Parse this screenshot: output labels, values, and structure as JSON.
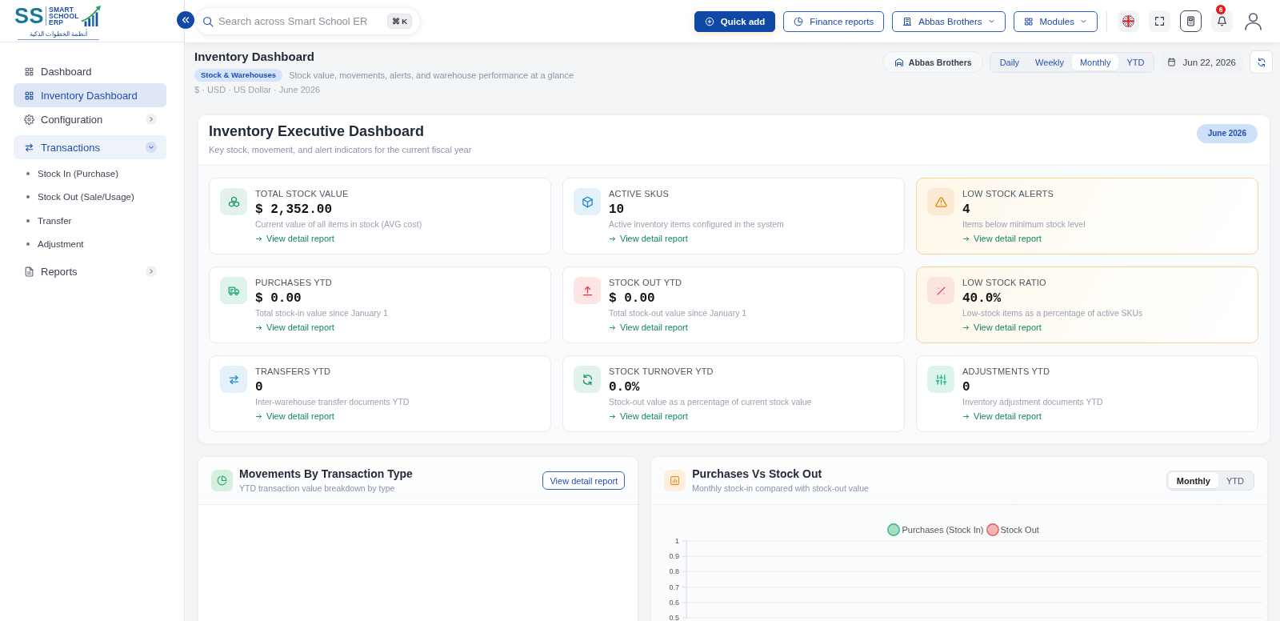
{
  "topbar": {
    "logo": {
      "mark": "SS",
      "lines": [
        "SMART",
        "SCHOOL",
        "ERP"
      ],
      "tagline": "أنظمة الخطوات الذكية"
    },
    "search": {
      "placeholder": "Search across Smart School ER",
      "shortcut": "⌘ K"
    },
    "quick_add": "Quick add",
    "finance_reports": "Finance reports",
    "company": "Abbas Brothers",
    "modules": "Modules",
    "notifications_count": "6"
  },
  "sidebar": {
    "items": [
      {
        "label": "Dashboard",
        "kind": "grid",
        "selected": false
      },
      {
        "label": "Inventory Dashboard",
        "kind": "grid",
        "selected": true
      },
      {
        "label": "Configuration",
        "kind": "settings",
        "selected": false,
        "expanded": false
      },
      {
        "label": "Transactions",
        "kind": "transfer",
        "selected": false,
        "expanded": true,
        "children": [
          {
            "label": "Stock In (Purchase)",
            "selected": false
          },
          {
            "label": "Stock Out (Sale/Usage)",
            "selected": false
          },
          {
            "label": "Transfer",
            "selected": false
          },
          {
            "label": "Adjustment",
            "selected": false
          }
        ]
      },
      {
        "label": "Reports",
        "kind": "document",
        "selected": false,
        "expanded": false
      }
    ]
  },
  "page_header": {
    "title": "Inventory Dashboard",
    "badge": "Stock & Warehouses",
    "subtitle": "Stock value, movements, alerts, and warehouse performance at a glance",
    "meta": "$ · USD · US Dollar · June 2026",
    "company": "Abbas Brothers",
    "periods": [
      {
        "label": "Daily",
        "selected": false
      },
      {
        "label": "Weekly",
        "selected": false
      },
      {
        "label": "Monthly",
        "selected": true
      },
      {
        "label": "YTD",
        "selected": false
      }
    ],
    "date": "Jun 22, 2026"
  },
  "executive": {
    "title": "Inventory Executive Dashboard",
    "subtitle": "Key stock, movement, and alert indicators for the current fiscal year",
    "period": "June 2026",
    "cards": [
      {
        "kind": "valuation",
        "label": "TOTAL STOCK VALUE",
        "value": "$ 2,352.00",
        "description": "Current value of all items in stock (AVG cost)",
        "link": "View detail report",
        "highlighted": false
      },
      {
        "kind": "skus",
        "label": "ACTIVE SKUS",
        "value": "10",
        "description": "Active inventory items configured in the system",
        "link": "View detail report",
        "highlighted": false
      },
      {
        "kind": "alerts",
        "label": "LOW STOCK ALERTS",
        "value": "4",
        "description": "Items below minimum stock level",
        "link": "View detail report",
        "highlighted": true
      },
      {
        "kind": "purchases",
        "label": "PURCHASES YTD",
        "value": "$ 0.00",
        "description": "Total stock-in value since January 1",
        "link": "View detail report",
        "highlighted": false
      },
      {
        "kind": "stockout",
        "label": "STOCK OUT YTD",
        "value": "$ 0.00",
        "description": "Total stock-out value since January 1",
        "link": "View detail report",
        "highlighted": false
      },
      {
        "kind": "ratio",
        "label": "LOW STOCK RATIO",
        "value": "40.0%",
        "description": "Low-stock items as a percentage of active SKUs",
        "link": "View detail report",
        "highlighted": true
      },
      {
        "kind": "transfers",
        "label": "TRANSFERS YTD",
        "value": "0",
        "description": "Inter-warehouse transfer documents YTD",
        "link": "View detail report",
        "highlighted": false
      },
      {
        "kind": "turnover",
        "label": "STOCK TURNOVER YTD",
        "value": "0.0%",
        "description": "Stock-out value as a percentage of current stock value",
        "link": "View detail report",
        "highlighted": false
      },
      {
        "kind": "adjustments",
        "label": "ADJUSTMENTS YTD",
        "value": "0",
        "description": "Inventory adjustment documents YTD",
        "link": "View detail report",
        "highlighted": false
      }
    ]
  },
  "movements_panel": {
    "title": "Movements By Transaction Type",
    "subtitle": "YTD transaction value breakdown by type",
    "action": "View detail report"
  },
  "purchases_panel": {
    "title": "Purchases Vs Stock Out",
    "subtitle": "Monthly stock-in compared with stock-out value",
    "periods": [
      {
        "label": "Monthly",
        "selected": true
      },
      {
        "label": "YTD",
        "selected": false
      }
    ],
    "chart_data": {
      "type": "bar",
      "series": [
        {
          "name": "Purchases (Stock In)",
          "color": "#36b37e"
        },
        {
          "name": "Stock Out",
          "color": "#e05a5a"
        }
      ],
      "ylim": [
        0.5,
        1
      ],
      "yticks": [
        1,
        0.9,
        0.8,
        0.7,
        0.6,
        0.5
      ],
      "grid": true
    }
  }
}
